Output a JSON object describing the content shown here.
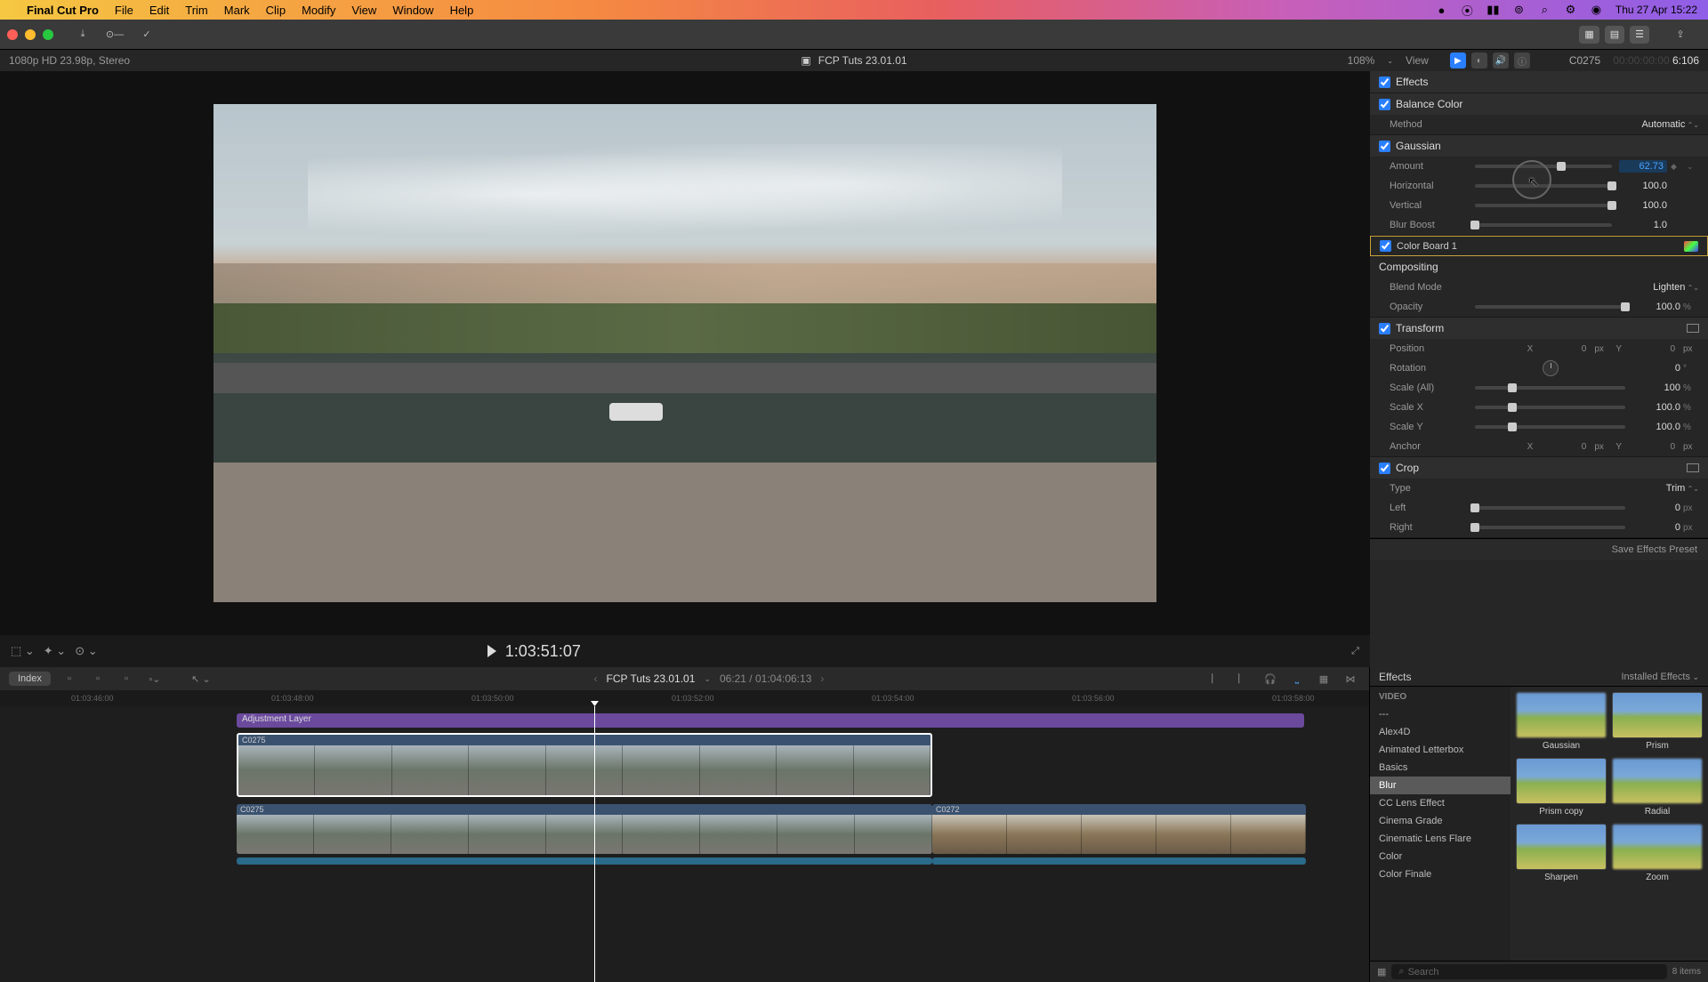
{
  "menubar": {
    "app": "Final Cut Pro",
    "items": [
      "File",
      "Edit",
      "Trim",
      "Mark",
      "Clip",
      "Modify",
      "View",
      "Window",
      "Help"
    ],
    "clock": "Thu 27 Apr  15:22"
  },
  "infobar": {
    "format": "1080p HD 23.98p, Stereo",
    "project": "FCP Tuts 23.01.01",
    "zoom": "108%",
    "view": "View",
    "clip": "C0275",
    "tc_dim": "00:00:00:00",
    "tc": "6:106"
  },
  "viewer": {
    "timecode": "1:03:51:07"
  },
  "inspector": {
    "effects_title": "Effects",
    "balance": {
      "title": "Balance Color",
      "method_label": "Method",
      "method": "Automatic"
    },
    "gaussian": {
      "title": "Gaussian",
      "amount_label": "Amount",
      "amount": "62.73",
      "horizontal_label": "Horizontal",
      "horizontal": "100.0",
      "vertical_label": "Vertical",
      "vertical": "100.0",
      "blurboost_label": "Blur Boost",
      "blurboost": "1.0"
    },
    "colorboard": {
      "title": "Color Board 1"
    },
    "compositing": {
      "title": "Compositing",
      "blend_label": "Blend Mode",
      "blend": "Lighten",
      "opacity_label": "Opacity",
      "opacity": "100.0",
      "opacity_unit": "%"
    },
    "transform": {
      "title": "Transform",
      "position_label": "Position",
      "pos_x": "0",
      "pos_y": "0",
      "rotation_label": "Rotation",
      "rotation": "0",
      "scaleall_label": "Scale (All)",
      "scaleall": "100",
      "scalex_label": "Scale X",
      "scalex": "100.0",
      "scaley_label": "Scale Y",
      "scaley": "100.0",
      "anchor_label": "Anchor",
      "anchor_x": "0",
      "anchor_y": "0",
      "px": "px",
      "deg": "°",
      "pct": "%"
    },
    "crop": {
      "title": "Crop",
      "type_label": "Type",
      "type": "Trim",
      "left_label": "Left",
      "left": "0",
      "right_label": "Right",
      "right": "0"
    },
    "save_preset": "Save Effects Preset"
  },
  "timeline": {
    "index": "Index",
    "name": "FCP Tuts 23.01.01",
    "time": "06:21 / 01:04:06:13",
    "ticks": [
      "01:03:46:00",
      "01:03:48:00",
      "01:03:50:00",
      "01:03:52:00",
      "01:03:54:00",
      "01:03:56:00",
      "01:03:58:00"
    ],
    "adj_layer": "Adjustment Layer",
    "clip1": "C0275",
    "clip2": "C0275",
    "clip3": "C0272"
  },
  "fx": {
    "title": "Effects",
    "installed": "Installed Effects",
    "cat_video": "VIDEO",
    "cats": [
      "---",
      "Alex4D",
      "Animated Letterbox",
      "Basics",
      "Blur",
      "CC Lens Effect",
      "Cinema Grade",
      "Cinematic Lens Flare",
      "Color",
      "Color Finale"
    ],
    "active_cat": "Blur",
    "items": [
      "Gaussian",
      "Prism",
      "Prism copy",
      "Radial",
      "Sharpen",
      "Zoom"
    ],
    "search_placeholder": "Search",
    "count": "8 items"
  }
}
